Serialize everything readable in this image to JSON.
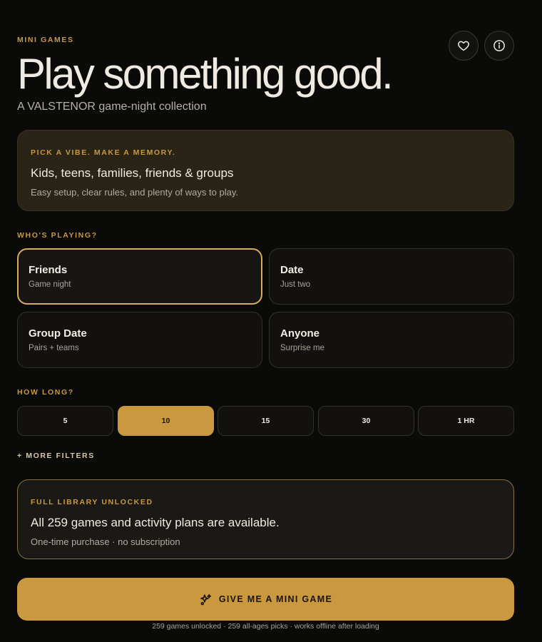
{
  "header": {
    "eyebrow": "MINI GAMES",
    "title": "Play something good.",
    "subtitle": "A VALSTENOR game-night collection",
    "icons": [
      "heart-icon",
      "info-icon"
    ]
  },
  "vibe": {
    "eyebrow": "PICK A VIBE. MAKE A MEMORY.",
    "main": "Kids, teens, families, friends & groups",
    "sub": "Easy setup, clear rules, and plenty of ways to play."
  },
  "who": {
    "label": "WHO'S PLAYING?",
    "options": [
      {
        "name": "Friends",
        "sub": "Game night",
        "selected": true
      },
      {
        "name": "Date",
        "sub": "Just two",
        "selected": false
      },
      {
        "name": "Group Date",
        "sub": "Pairs + teams",
        "selected": false
      },
      {
        "name": "Anyone",
        "sub": "Surprise me",
        "selected": false
      }
    ]
  },
  "duration": {
    "label": "HOW LONG?",
    "options": [
      "5",
      "10",
      "15",
      "30",
      "1 HR"
    ],
    "selected": "10"
  },
  "more_filters": "+ MORE FILTERS",
  "library": {
    "eyebrow": "FULL LIBRARY UNLOCKED",
    "main": "All 259 games and activity plans are available.",
    "sub": "One-time purchase · no subscription"
  },
  "cta": {
    "label": "GIVE ME A MINI GAME",
    "icon": "sparkles-icon"
  },
  "footer": "259 games unlocked · 259 all-ages picks · works offline after loading",
  "colors": {
    "background": "#0a0a09",
    "accent": "#c9983f",
    "card": "#121110"
  }
}
